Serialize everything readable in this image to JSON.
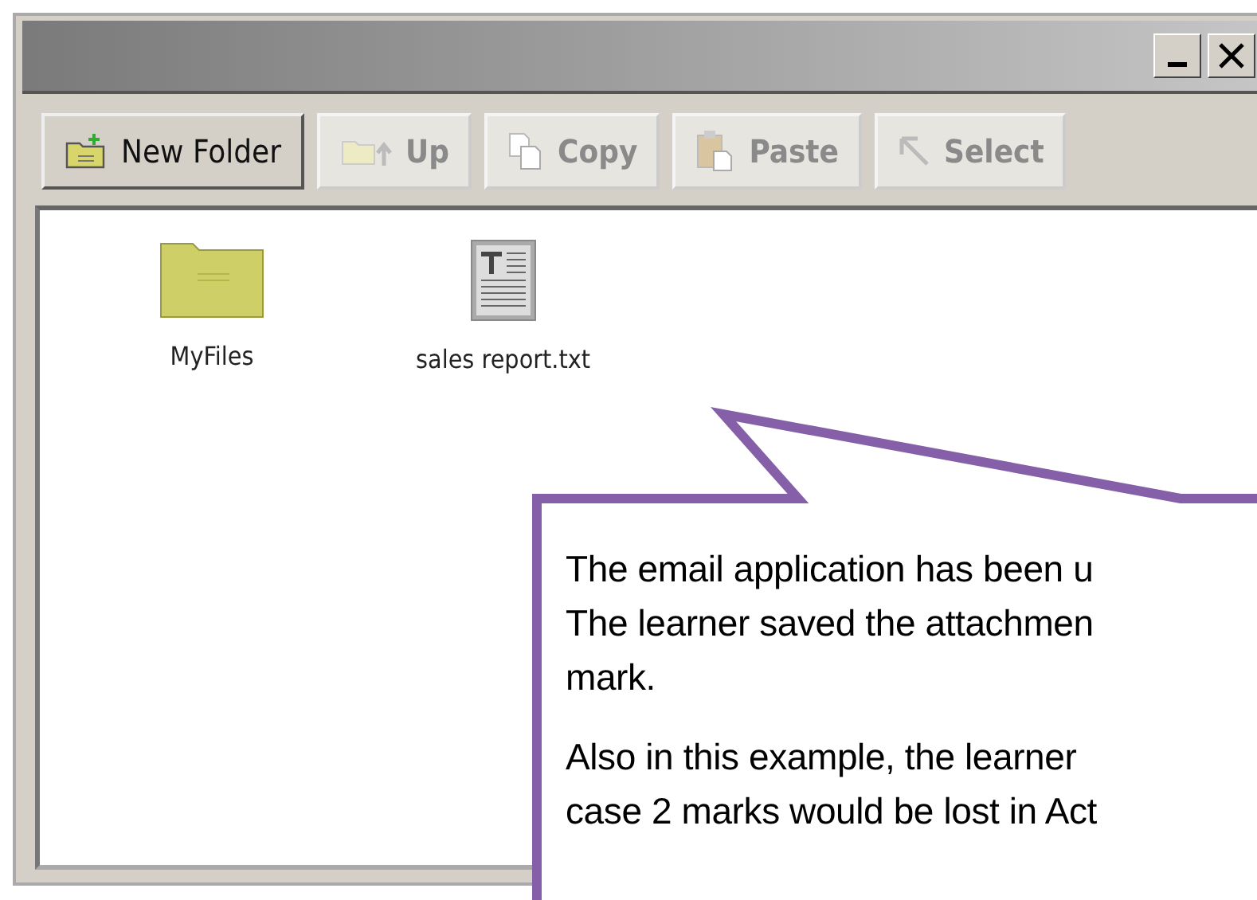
{
  "window": {
    "controls": [
      {
        "kind": "minimize"
      },
      {
        "kind": "close"
      }
    ]
  },
  "toolbar": [
    {
      "label": "New Folder",
      "kind": "new-folder",
      "disabled": false
    },
    {
      "label": "Up",
      "kind": "up",
      "disabled": true
    },
    {
      "label": "Copy",
      "kind": "copy",
      "disabled": true
    },
    {
      "label": "Paste",
      "kind": "paste",
      "disabled": true
    },
    {
      "label": "Select",
      "kind": "select",
      "disabled": true
    }
  ],
  "files": [
    {
      "name": "MyFiles",
      "kind": "folder"
    },
    {
      "name": "sales report.txt",
      "kind": "text"
    }
  ],
  "callout": {
    "paragraphs": [
      "The email application has been u\nThe learner saved the attachmen\nmark.",
      "Also in this example, the learner\ncase 2 marks would be lost in Act"
    ]
  }
}
